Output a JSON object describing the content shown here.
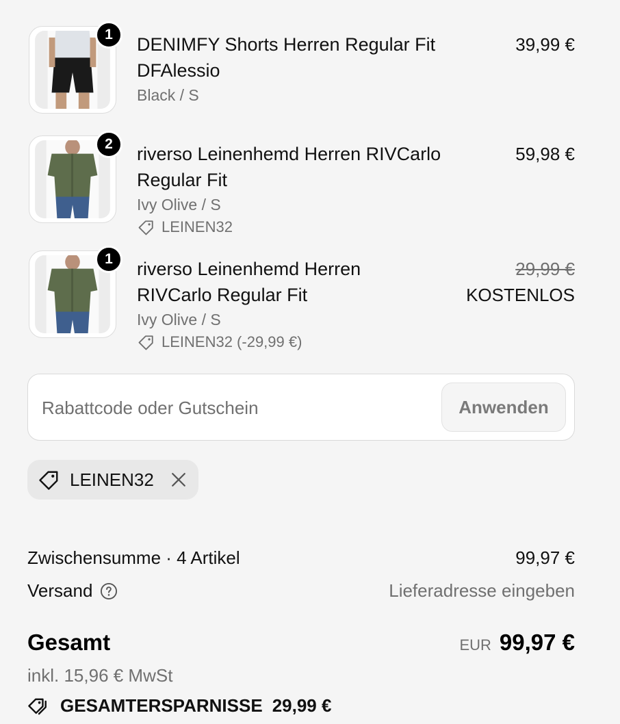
{
  "cart": {
    "items": [
      {
        "quantity": "1",
        "title_line1": "DENIMFY Shorts Herren Regular Fit",
        "title_line2": "DFAlessio",
        "variant": "Black / S",
        "price": "39,99 €"
      },
      {
        "quantity": "2",
        "title_line1": "riverso Leinenhemd Herren RIVCarlo",
        "title_line2": "Regular Fit",
        "variant": "Ivy Olive / S",
        "discount": "LEINEN32",
        "price": "59,98 €"
      },
      {
        "quantity": "1",
        "title_line1": "riverso Leinenhemd Herren",
        "title_line2": "RIVCarlo Regular Fit",
        "variant": "Ivy Olive / S",
        "discount": "LEINEN32 (-29,99 €)",
        "original_price": "29,99 €",
        "price": "KOSTENLOS"
      }
    ]
  },
  "discount_form": {
    "placeholder": "Rabattcode oder Gutschein",
    "apply_label": "Anwenden"
  },
  "applied_code": {
    "label": "LEINEN32"
  },
  "summary": {
    "subtotal_label": "Zwischensumme · 4 Artikel",
    "subtotal_value": "99,97 €",
    "shipping_label": "Versand",
    "shipping_value": "Lieferadresse eingeben",
    "total_label": "Gesamt",
    "total_currency": "EUR",
    "total_value": "99,97 €",
    "tax_note": "inkl. 15,96 € MwSt",
    "savings_label": "GESAMTERSPARNISSE",
    "savings_value": "29,99 €"
  },
  "colors": {
    "background": "#f5f5f5",
    "muted_text": "#707070",
    "badge": "#000000",
    "shirt": "#5e6d4c",
    "jeans": "#3f5f8e",
    "shorts": "#1a1a1a"
  },
  "icons": [
    "tag-icon",
    "close-icon",
    "help-circle-icon",
    "double-tag-icon"
  ]
}
